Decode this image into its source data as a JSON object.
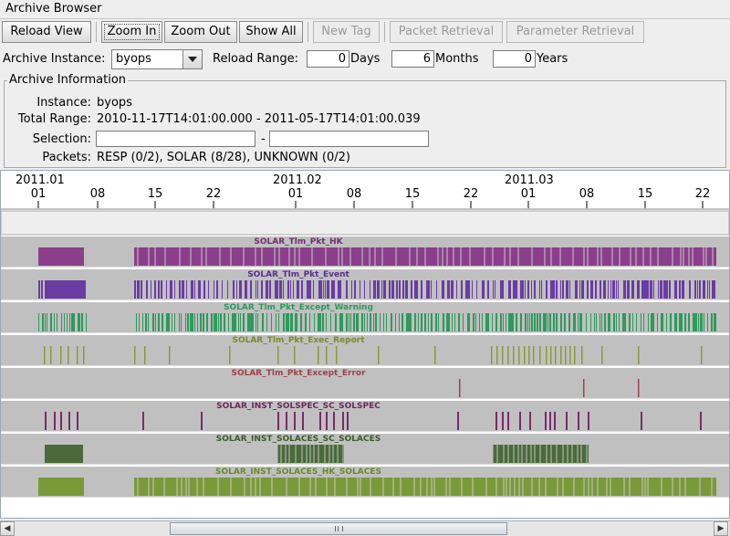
{
  "window": {
    "title": "Archive Browser"
  },
  "toolbar": {
    "reload_view": "Reload View",
    "zoom_in": "Zoom In",
    "zoom_out": "Zoom Out",
    "show_all": "Show All",
    "new_tag": "New Tag",
    "packet_retrieval": "Packet Retrieval",
    "parameter_retrieval": "Parameter Retrieval"
  },
  "controls": {
    "instance_label": "Archive Instance:",
    "instance_value": "byops",
    "reload_range_label": "Reload Range:",
    "days_value": "0",
    "days_label": "Days",
    "months_value": "6",
    "months_label": "Months",
    "years_value": "0",
    "years_label": "Years"
  },
  "info": {
    "legend": "Archive Information",
    "instance_key": "Instance:",
    "instance_value": "byops",
    "total_range_key": "Total Range:",
    "total_range_value": "2010-11-17T14:01:00.000 - 2011-05-17T14:01:00.039",
    "selection_key": "Selection:",
    "selection_start": "",
    "selection_dash": "-",
    "selection_end": "",
    "packets_key": "Packets:",
    "packets_value": "RESP (0/2), SOLAR (8/28), UNKNOWN (0/2)"
  },
  "timeline": {
    "months": [
      "2011.01",
      "2011.02",
      "2011.03"
    ],
    "day_ticks": [
      "01",
      "08",
      "15",
      "22",
      "01",
      "08",
      "15",
      "22",
      "01",
      "08",
      "15",
      "22"
    ],
    "rows": [
      {
        "name": "SOLAR_Tlm_Pkt_HK",
        "color": "#8b3f8b",
        "label_color": "#6e2f6e"
      },
      {
        "name": "SOLAR_Tlm_Pkt_Event",
        "color": "#6a3ca4",
        "label_color": "#56308a"
      },
      {
        "name": "SOLAR_Tlm_Pkt_Except_Warning",
        "color": "#2e9a5c",
        "label_color": "#2e9a5c"
      },
      {
        "name": "SOLAR_Tlm_Pkt_Exec_Report",
        "color": "#8a9a3a",
        "label_color": "#7a8a30"
      },
      {
        "name": "SOLAR_Tlm_Pkt_Except_Error",
        "color": "#a04050",
        "label_color": "#a04050"
      },
      {
        "name": "SOLAR_INST_SOLSPEC_SC_SOLSPEC",
        "color": "#7a2a6a",
        "label_color": "#6a2a5a"
      },
      {
        "name": "SOLAR_INST_SOLACES_SC_SOLACES",
        "color": "#4a6a3a",
        "label_color": "#3a5a2a"
      },
      {
        "name": "SOLAR_INST_SOLACES_HK_SOLACES",
        "color": "#7a9a3a",
        "label_color": "#6a8a2a"
      }
    ]
  },
  "scrollbar": {
    "left_arrow": "◀",
    "right_arrow": "▶"
  }
}
